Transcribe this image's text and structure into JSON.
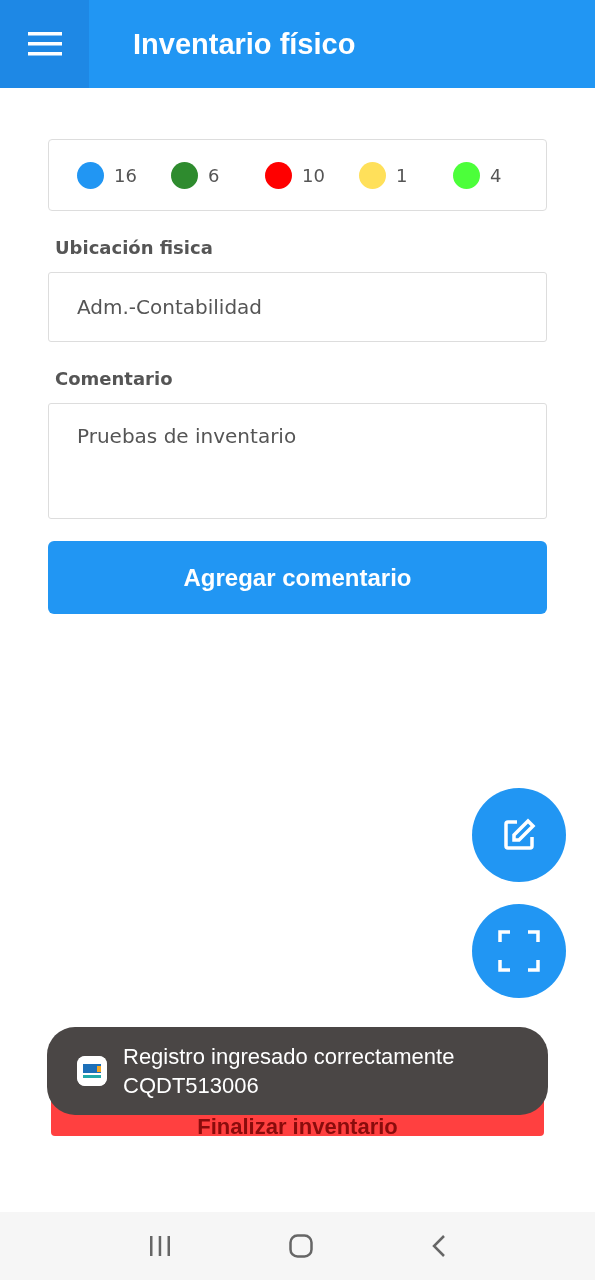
{
  "app_bar": {
    "title": "Inventario físico"
  },
  "legend": [
    {
      "color": "#2196f3",
      "count": "16"
    },
    {
      "color": "#2e8b2e",
      "count": "6"
    },
    {
      "color": "#ff0000",
      "count": "10"
    },
    {
      "color": "#ffe05a",
      "count": "1"
    },
    {
      "color": "#4cff3a",
      "count": "4"
    }
  ],
  "location": {
    "label": "Ubicación fisica",
    "value": "Adm.-Contabilidad"
  },
  "comment": {
    "label": "Comentario",
    "value": "Pruebas de inventario"
  },
  "add_comment_button": "Agregar comentario",
  "finish_button": "Finalizar inventario",
  "toast": {
    "message": "Registro ingresado correctamente CQDT513006"
  }
}
